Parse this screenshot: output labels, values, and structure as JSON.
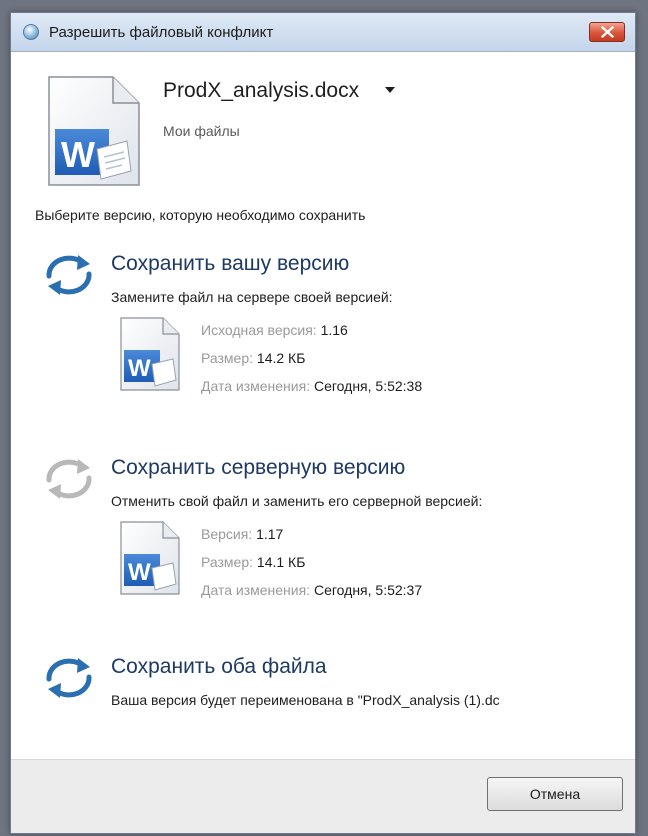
{
  "window": {
    "title": "Разрешить файловый конфликт",
    "close_icon": "close-icon"
  },
  "file": {
    "name": "ProdX_analysis.docx",
    "location": "Мои файлы"
  },
  "instruction": "Выберите версию, которую необходимо сохранить",
  "options": [
    {
      "title": "Сохранить вашу версию",
      "description": "Замените файл на сервере своей версией:",
      "meta": [
        {
          "key": "Исходная версия:",
          "value": "1.16"
        },
        {
          "key": "Размер:",
          "value": "14.2 КБ"
        },
        {
          "key": "Дата изменения:",
          "value": "Сегодня, 5:52:38"
        }
      ]
    },
    {
      "title": "Сохранить серверную версию",
      "description": "Отменить свой файл и заменить его серверной версией:",
      "meta": [
        {
          "key": "Версия:",
          "value": "1.17"
        },
        {
          "key": "Размер:",
          "value": "14.1 КБ"
        },
        {
          "key": "Дата изменения:",
          "value": "Сегодня, 5:52:37"
        }
      ]
    },
    {
      "title": "Сохранить оба файла",
      "description": "Ваша версия будет переименована в \"ProdX_analysis (1).dc"
    }
  ],
  "footer": {
    "cancel_label": "Отмена"
  },
  "colors": {
    "sync_blue": "#2a6fb0",
    "sync_grey": "#b8b8b8",
    "word_blue": "#1f5db6",
    "title_text": "#1e3a63"
  }
}
